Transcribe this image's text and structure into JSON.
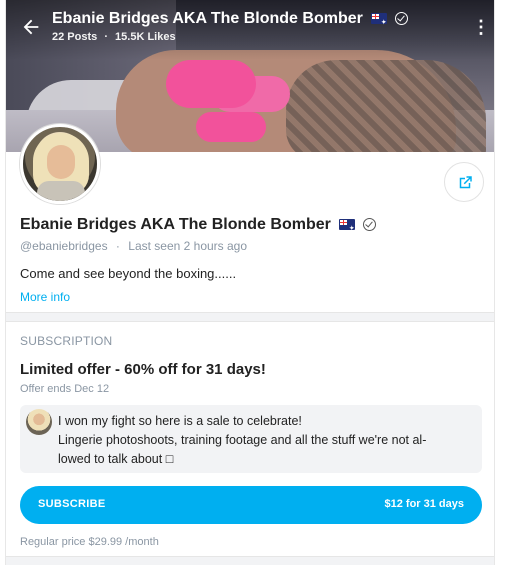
{
  "header": {
    "title": "Ebanie Bridges AKA The Blonde Bomber",
    "posts": "22 Posts",
    "separator": "·",
    "likes": "15.5K Likes"
  },
  "profile": {
    "name": "Ebanie Bridges AKA The Blonde Bomber",
    "handle": "@ebaniebridges",
    "separator": "·",
    "last_seen": "Last seen 2 hours ago",
    "bio": "Come and see beyond the boxing......",
    "more_info": "More info"
  },
  "subscription": {
    "heading": "SUBSCRIPTION",
    "offer_title": "Limited offer - 60% off for 31 days!",
    "offer_ends": "Offer ends Dec 12",
    "message_line1": "I won my fight so here is a sale to celebrate!",
    "message_line2": "Lingerie photoshoots, training footage and all the stuff we're not al-",
    "message_line3": "lowed to talk about □",
    "button_label": "SUBSCRIBE",
    "button_price": "$12 for 31 days",
    "regular_price": "Regular price $29.99 /month"
  },
  "colors": {
    "accent": "#00aff0",
    "muted": "#8a96a3"
  },
  "icons": [
    "back-arrow-icon",
    "more-vertical-icon",
    "australia-flag-icon",
    "verified-badge-icon",
    "share-icon"
  ]
}
